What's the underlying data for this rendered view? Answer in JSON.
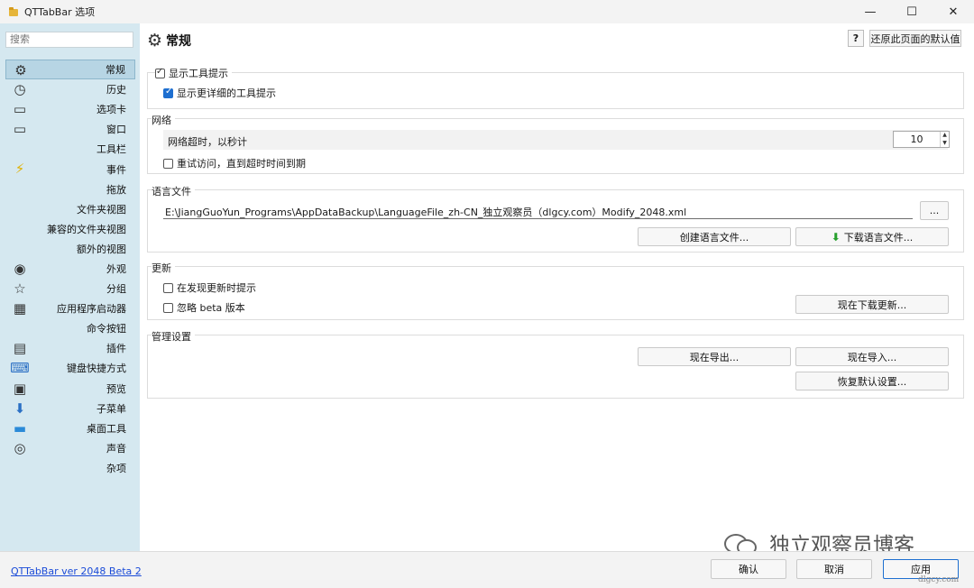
{
  "window": {
    "title": "QTTabBar 选项",
    "controls": {
      "minimize": "—",
      "maximize": "☐",
      "close": "✕"
    }
  },
  "sidebar": {
    "search_placeholder": "搜索",
    "items": [
      {
        "label": "常规",
        "icon": "gear-icon",
        "selected": true
      },
      {
        "label": "历史",
        "icon": "clock-icon"
      },
      {
        "label": "选项卡",
        "icon": "tab-icon"
      },
      {
        "label": "窗口",
        "icon": "window-icon"
      },
      {
        "label": "工具栏",
        "icon": ""
      },
      {
        "label": "事件",
        "icon": "lightning-icon"
      },
      {
        "label": "拖放",
        "icon": ""
      },
      {
        "label": "文件夹视图",
        "icon": ""
      },
      {
        "label": "兼容的文件夹视图",
        "icon": ""
      },
      {
        "label": "额外的视图",
        "icon": ""
      },
      {
        "label": "外观",
        "icon": "eye-icon"
      },
      {
        "label": "分组",
        "icon": "star-icon"
      },
      {
        "label": "应用程序启动器",
        "icon": "windows-icon"
      },
      {
        "label": "命令按钮",
        "icon": ""
      },
      {
        "label": "插件",
        "icon": "plugin-icon"
      },
      {
        "label": "键盘快捷方式",
        "icon": "keyboard-icon"
      },
      {
        "label": "预览",
        "icon": "preview-icon"
      },
      {
        "label": "子菜单",
        "icon": "submenu-icon"
      },
      {
        "label": "桌面工具",
        "icon": "desktop-icon"
      },
      {
        "label": "声音",
        "icon": "speaker-icon"
      },
      {
        "label": "杂项",
        "icon": ""
      }
    ]
  },
  "header": {
    "title": "常规",
    "help_label": "?",
    "restore_label": "还原此页面的默认值"
  },
  "tooltips": {
    "show_tooltips": {
      "label": "显示工具提示",
      "checked": true
    },
    "show_detailed": {
      "label": "显示更详细的工具提示",
      "checked": true
    }
  },
  "network": {
    "group_label": "网络",
    "timeout_label": "网络超时，以秒计",
    "timeout_value": "10",
    "retry": {
      "label": "重试访问，直到超时时间到期",
      "checked": false
    }
  },
  "language": {
    "group_label": "语言文件",
    "path": "E:\\JiangGuoYun_Programs\\AppDataBackup\\LanguageFile_zh-CN_独立观察员（dlgcy.com）Modify_2048.xml",
    "browse_label": "...",
    "create_label": "创建语言文件...",
    "download_label": "下载语言文件..."
  },
  "update": {
    "group_label": "更新",
    "notify": {
      "label": "在发现更新时提示",
      "checked": false
    },
    "ignore_beta": {
      "label": "忽略 beta 版本",
      "checked": false
    },
    "download_now_label": "现在下载更新..."
  },
  "admin": {
    "group_label": "管理设置",
    "export_label": "现在导出...",
    "import_label": "现在导入...",
    "reset_label": "恢复默认设置..."
  },
  "footer": {
    "version_link": "QTTabBar ver 2048 Beta 2",
    "ok_label": "确认",
    "cancel_label": "取消",
    "apply_label": "应用"
  },
  "watermark": {
    "text": "独立观察员博客",
    "url": "dlgcy.com"
  }
}
